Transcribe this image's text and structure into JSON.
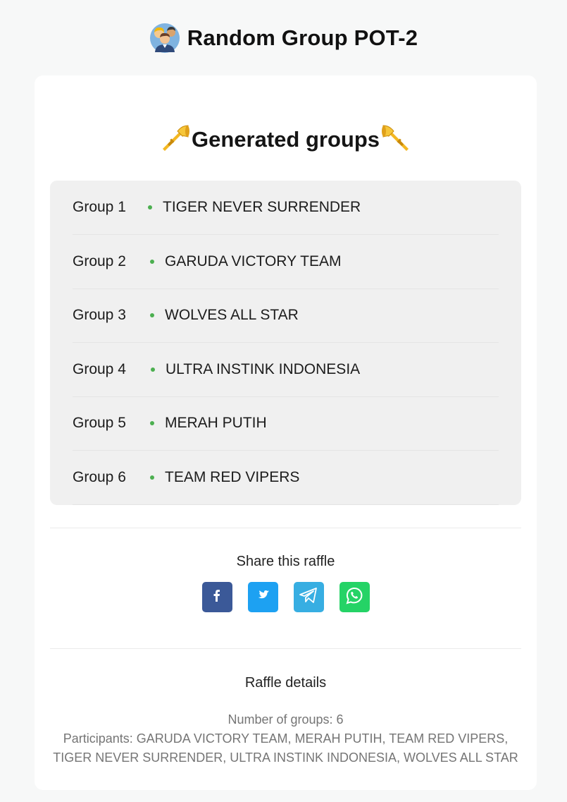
{
  "header": {
    "title": "Random Group POT-2",
    "icon": "people-group-icon"
  },
  "results": {
    "heading": "Generated groups",
    "heading_icon": "trumpet-icon",
    "groups": [
      {
        "label": "Group 1",
        "team": "TIGER NEVER SURRENDER"
      },
      {
        "label": "Group 2",
        "team": "GARUDA VICTORY TEAM"
      },
      {
        "label": "Group 3",
        "team": "WOLVES ALL STAR"
      },
      {
        "label": "Group 4",
        "team": "ULTRA INSTINK INDONESIA"
      },
      {
        "label": "Group 5",
        "team": "MERAH PUTIH"
      },
      {
        "label": "Group 6",
        "team": "TEAM RED VIPERS"
      }
    ],
    "bullet_color": "#4caf50"
  },
  "share": {
    "title": "Share this raffle",
    "buttons": [
      {
        "name": "facebook",
        "icon": "facebook-icon",
        "color": "#3b5998"
      },
      {
        "name": "twitter",
        "icon": "twitter-icon",
        "color": "#1da1f2"
      },
      {
        "name": "telegram",
        "icon": "telegram-icon",
        "color": "#37aee2"
      },
      {
        "name": "whatsapp",
        "icon": "whatsapp-icon",
        "color": "#25d366"
      }
    ]
  },
  "details": {
    "title": "Raffle details",
    "groups_line": "Number of groups: 6",
    "participants_line": "Participants: GARUDA VICTORY TEAM, MERAH PUTIH, TEAM RED VIPERS, TIGER NEVER SURRENDER, ULTRA INSTINK INDONESIA, WOLVES ALL STAR"
  }
}
